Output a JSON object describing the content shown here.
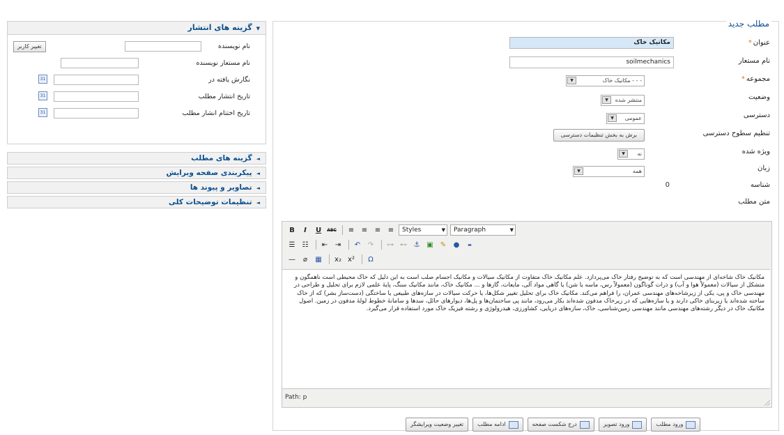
{
  "editor": {
    "legend": "مطلب جدید",
    "fields": {
      "title_label": "عنوان",
      "title_value": "مکانیک خاک",
      "alias_label": "نام مستعار",
      "alias_value": "soilmechanics",
      "category_label": "مجموعه",
      "category_value": "- - - مکانیک خاک",
      "state_label": "وضعیت",
      "state_value": "منتشر شده",
      "access_label": "دسترسی",
      "access_value": "عمومی",
      "acl_label": "تنظیم سطوح دسترسی",
      "acl_button": "برش به بخش تنظیمات دسترسی",
      "featured_label": "ویژه شده",
      "featured_value": "نه",
      "language_label": "زبان",
      "language_value": "همه",
      "id_label": "شناسه",
      "id_value": "0",
      "text_label": "متن مطلب",
      "required_mark": "*"
    },
    "toolbar": {
      "styles_label": "Styles",
      "format_label": "Paragraph",
      "bold": "B",
      "italic": "I",
      "underline": "U",
      "strike": "ABC",
      "omega": "Ω"
    },
    "content": "مکانیک خاک شاخه‌ای از مهندسی است که به توضیح رفتار خاک می‌پردازد. علم مکانیک خاک متفاوت از مکانیک سیالات و مکانیک اجسام صلب است به این دلیل که خاک محیطی است ناهمگون و متشکل از سیالات (معمولاً هوا و آب) و ذرات گوناگون (معمولاً رس، ماسه یا شن) یا گاهی مواد آلی، مایعات، گازها و ... مکانیک خاک، مانند مکانیک سنگ، پایهٔ علمی لازم برای تحلیل و طراحی در مهندسی خاک و پی، یکی از زیرشاخه‌های مهندسی عمران، را فراهم می‌کند. مکانیک خاک برای تحلیل تغییر شکل‌ها، یا حرکت سیالات در سازه‌های طبیعی یا ساختگی (دست‌ساز بشر) که از خاک ساخته شده‌اند یا زیربنای خاکی دارند و یا سازه‌هایی که در زیرخاک مدفون شده‌اند بکار می‌رود، مانند پی ساختمان‌ها و پل‌ها، دیوارهای حائل، سدها و سامانهٔ خطوط لولهٔ مدفون در زمین. اصول مکانیک خاک در دیگر رشته‌های مهندسی مانند مهندسی زمین‌شناسی، خاک، سازه‌های دریایی، کشاورزی، هیدرولوژی و رشته فیزیک خاک مورد استفاده قرار می‌گیرد.",
    "path": "Path: p",
    "bottom_buttons": [
      "ورود مطلب",
      "ورود تصویر",
      "درج شکست صفحه",
      "ادامه مطلب",
      "تغییر وضعیت ویرایشگر"
    ]
  },
  "publishing": {
    "title": "گزینه های انتشار",
    "author_label": "نام نویسنده",
    "change_user_button": "تغییر کاربر",
    "author_alias_label": "نام مستعار نویسنده",
    "modified_label": "نگارش یافته در",
    "publish_up_label": "تاریخ انتشار مطلب",
    "publish_down_label": "تاریخ اختتام انشار مطلب"
  },
  "collapsed_panels": [
    "گزینه های مطلب",
    "پیکربندی صفحه ویرایش",
    "تصاویر و پیوند ها",
    "تنظیمات توضیحات کلی"
  ]
}
